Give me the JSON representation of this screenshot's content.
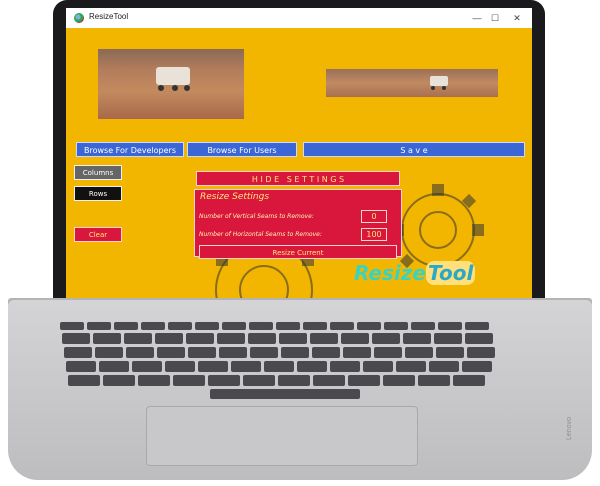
{
  "window": {
    "title": "ResizeTool",
    "minimize_icon": "—",
    "maximize_icon": "☐",
    "close_icon": "✕"
  },
  "buttons": {
    "browse_developers": "Browse For Developers",
    "browse_users": "Browse For Users",
    "save": "S a v e",
    "columns": "Columns",
    "rows": "Rows",
    "clear": "Clear",
    "hide_settings": "H I D E   S E T T I N G S",
    "resize_current": "Resize Current"
  },
  "settings": {
    "title": "Resize Settings",
    "vertical_label": "Number of Vertical Seams to Remove:",
    "vertical_value": "0",
    "horizontal_label": "Number of Horizontal Seams to Remove:",
    "horizontal_value": "100"
  },
  "logo": {
    "part1": "Resize",
    "part2": "Tool"
  },
  "laptop": {
    "brand": "Lenovo"
  },
  "colors": {
    "background": "#f2b600",
    "accent_blue": "#3b66d6",
    "accent_red": "#d9163c",
    "button_dark": "#111111",
    "button_gray": "#666666"
  }
}
